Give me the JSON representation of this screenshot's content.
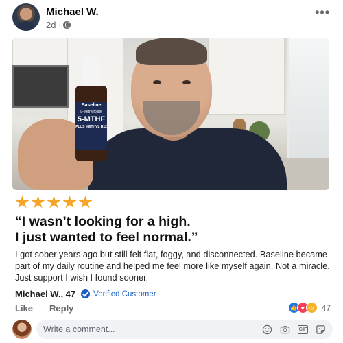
{
  "post": {
    "author": "Michael W.",
    "time": "2d ·",
    "more_icon": "more-horizontal-icon"
  },
  "product": {
    "brand": "Baseline",
    "sub": "L-Methylfolate",
    "name": "5-MTHF",
    "tag": "PLUS METHYL B12"
  },
  "rating": {
    "stars": 5
  },
  "quote": "“I wasn’t looking for a high.\nI just wanted to feel normal.”",
  "quote_line1": "“I wasn’t looking for a high.",
  "quote_line2": "I just wanted to feel normal.”",
  "body": "I got sober years ago but still felt flat, foggy, and disconnected. Baseline became part of my daily routine and helped me feel more like myself again. Not a miracle. Just support I wish I found sooner.",
  "byline": {
    "name": "Michael W., 47",
    "verified": "Verified Customer"
  },
  "actions": {
    "like": "Like",
    "reply": "Reply"
  },
  "reactions": {
    "count": "47",
    "types": [
      "like",
      "love",
      "care"
    ]
  },
  "comment": {
    "placeholder": "Write a comment...",
    "icons": [
      "emoji-icon",
      "camera-icon",
      "gif-icon",
      "sticker-icon"
    ],
    "gif_label": "GIF"
  },
  "colors": {
    "star": "#f4a62a",
    "verified": "#1b5fc1",
    "like": "#1877f2",
    "love": "#f33e58",
    "care": "#f7b125"
  }
}
